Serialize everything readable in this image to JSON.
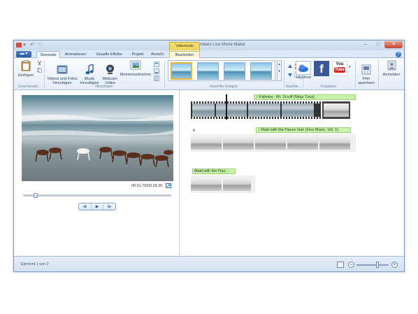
{
  "window": {
    "title": "Mein Film - Windows Live Movie Maker",
    "context_tab": "Videotools"
  },
  "tabs": [
    {
      "label": "Startseite"
    },
    {
      "label": "Animationen"
    },
    {
      "label": "Visuelle Effekte"
    },
    {
      "label": "Projekt"
    },
    {
      "label": "Ansicht"
    },
    {
      "label": "Bearbeiten"
    }
  ],
  "ribbon": {
    "paste": "Einfügen",
    "add_videos": "Videos und Fotos\nhinzufügen",
    "add_music": "Musik\nhinzufügen",
    "webcam": "Webcam\n-Video",
    "snapshot": "Momentaufnahme",
    "skydrive": "SkyDrive",
    "save_movie": "Film\nspeichern",
    "sign_in": "Anmelden",
    "groups": {
      "clipboard": "Zwischenabl...",
      "add": "Hinzufügen",
      "autofilm": "AutoFilm-Designs",
      "edit": "Bearbei...",
      "share": "Freigeben"
    }
  },
  "preview": {
    "time": "00:01,76/00:28,39",
    "seek_fraction": 0.07
  },
  "storyboard": {
    "music_1": "Kalimba - Mr. Scruff (Ninja Tuna)",
    "k_label": "K",
    "music_2": "Maid with the Flaxen Hair (Fine Music, Vol. 1)",
    "caption_3": "Maid with the Flax..."
  },
  "status": {
    "text": "Element 1 von 2",
    "zoom_fraction": 0.66
  },
  "colors": {
    "accent": "#2a5aa3",
    "caption_bg": "#c9f1a9",
    "context": "#efd35a"
  }
}
